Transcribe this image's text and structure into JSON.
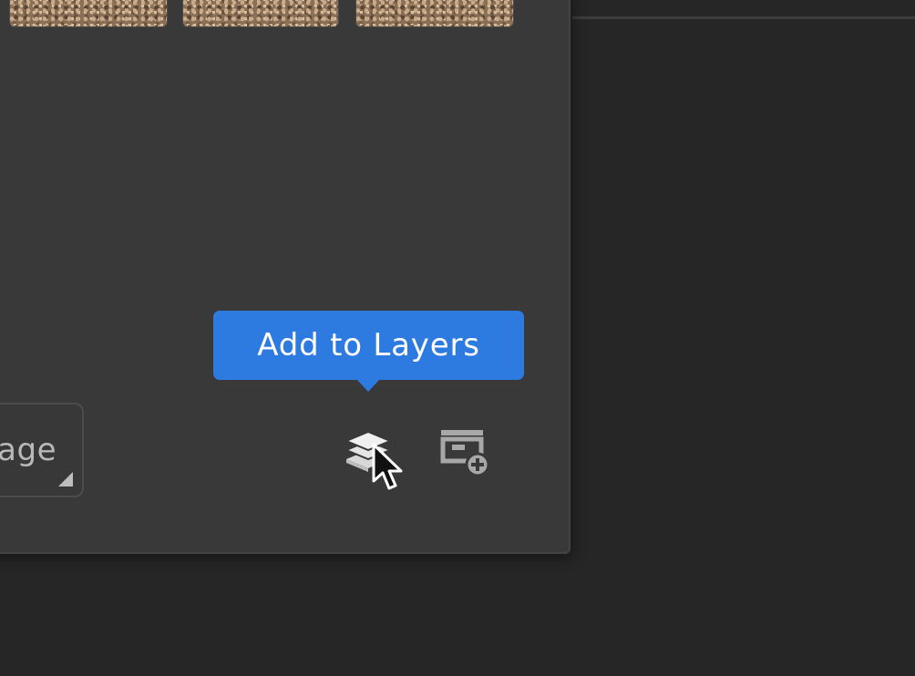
{
  "panel": {
    "thumbnails": [
      {
        "name": "thumbnail-1"
      },
      {
        "name": "thumbnail-2"
      },
      {
        "name": "thumbnail-3"
      }
    ],
    "image_button_label": "age"
  },
  "tooltip": {
    "text": "Add to Layers"
  },
  "icons": {
    "add_to_layers": "layers-stack-icon",
    "add_to_library": "library-add-icon",
    "cursor": "mouse-pointer-icon"
  },
  "colors": {
    "tooltip_bg": "#2d7ae0",
    "panel_bg": "#393939",
    "app_bg": "#262626",
    "icon": "#d8d8d8",
    "icon_muted": "#a8a8a8"
  }
}
